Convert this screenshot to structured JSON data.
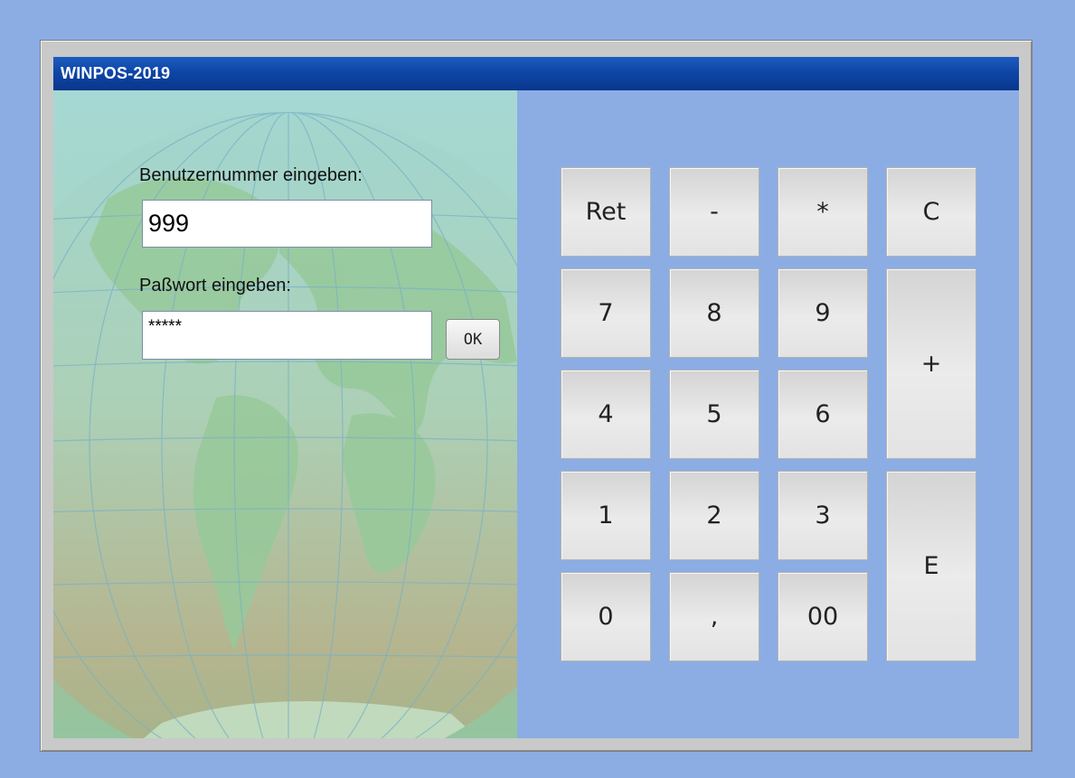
{
  "window": {
    "title": "WINPOS-2019"
  },
  "login": {
    "user_label": "Benutzernummer eingeben:",
    "user_value": "999",
    "password_label": "Paßwort eingeben:",
    "password_value": "*****",
    "ok_label": "OK"
  },
  "keypad": {
    "ret": "Ret",
    "minus": "-",
    "multiply": "*",
    "clear": "C",
    "k7": "7",
    "k8": "8",
    "k9": "9",
    "plus": "+",
    "k4": "4",
    "k5": "5",
    "k6": "6",
    "k1": "1",
    "k2": "2",
    "k3": "3",
    "enter": "E",
    "k0": "0",
    "comma": ",",
    "k00": "00"
  }
}
